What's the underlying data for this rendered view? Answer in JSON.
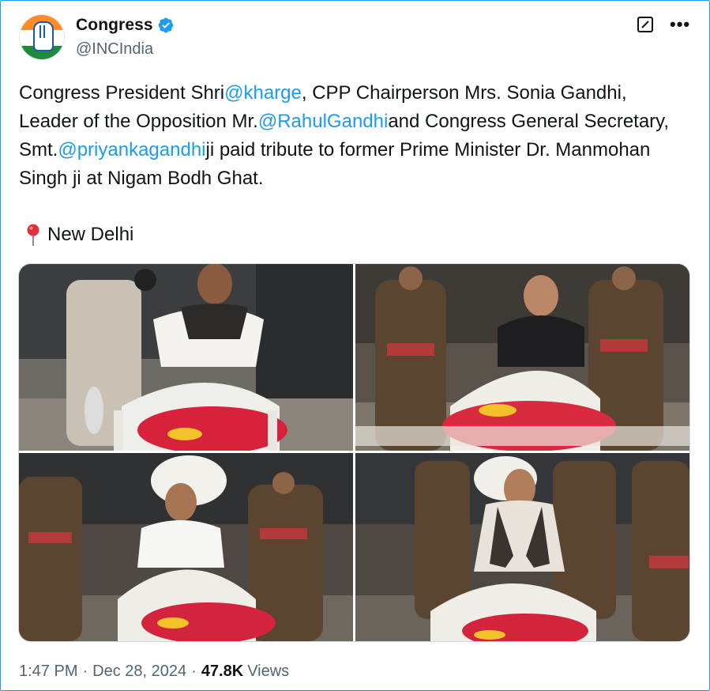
{
  "author": {
    "display_name": "Congress",
    "handle": "@INCIndia",
    "verified_icon": "verified-badge-icon",
    "avatar_icon": "congress-hand-logo"
  },
  "toolbar": {
    "grok_icon": "grok-icon",
    "more_label": "•••"
  },
  "tweet": {
    "segments": [
      {
        "text": "Congress President Shri",
        "mention": false
      },
      {
        "text": "@kharge",
        "mention": true
      },
      {
        "text": ", CPP Chairperson Mrs. Sonia Gandhi, Leader of the Opposition Mr.",
        "mention": false
      },
      {
        "text": "@RahulGandhi",
        "mention": true
      },
      {
        "text": "and Congress General Secretary, Smt.",
        "mention": false
      },
      {
        "text": "@priyankagandhi",
        "mention": true
      },
      {
        "text": "ji paid tribute to former Prime Minister Dr. Manmohan Singh ji at Nigam Bodh Ghat.",
        "mention": false
      }
    ],
    "location": "New Delhi",
    "location_icon": "round-pushpin-icon"
  },
  "media": {
    "photos": [
      {
        "name": "photo-kharge-tribute"
      },
      {
        "name": "photo-sonia-gandhi-tribute"
      },
      {
        "name": "photo-rahul-gandhi-tribute"
      },
      {
        "name": "photo-priyanka-gandhi-tribute"
      }
    ]
  },
  "meta": {
    "time": "1:47 PM",
    "separator": "·",
    "date": "Dec 28, 2024",
    "views_count": "47.8K",
    "views_label": "Views"
  },
  "colors": {
    "accent": "#1d9bf0",
    "text": "#0f1419",
    "muted": "#536471"
  }
}
